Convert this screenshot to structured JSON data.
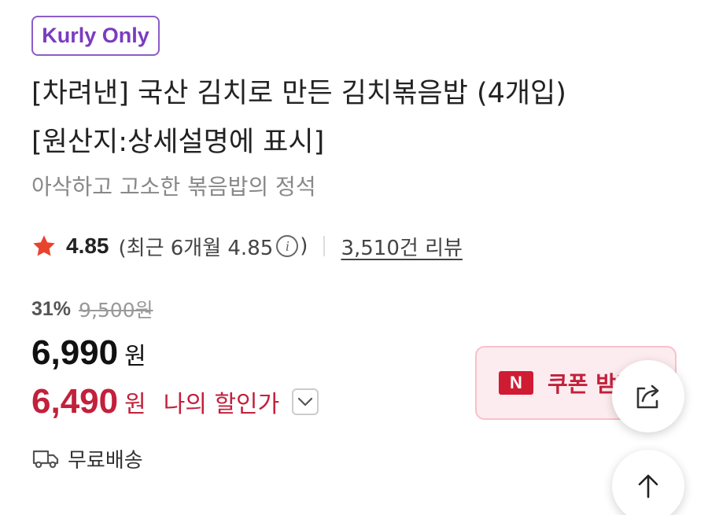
{
  "badge": {
    "label": "Kurly Only"
  },
  "product": {
    "title_line1": "[차려낸] 국산 김치로 만든 김치볶음밥 (4개입)",
    "title_line2": "[원산지:상세설명에 표시]",
    "subtitle": "아삭하고 고소한 볶음밥의 정석"
  },
  "rating": {
    "value": "4.85",
    "recent_prefix": "(최근 6개월 4.85",
    "recent_suffix": ")",
    "info_icon": "i",
    "review_count": "3,510건 리뷰"
  },
  "pricing": {
    "discount_rate": "31%",
    "original_price": "9,500원",
    "price": "6,990",
    "currency": "원",
    "my_price": "6,490",
    "my_currency": "원",
    "my_price_label": "나의 할인가"
  },
  "coupon": {
    "logo": "N",
    "label": "쿠폰 받기"
  },
  "shipping": {
    "label": "무료배송"
  },
  "icons": {
    "rating": "star-icon",
    "info": "info-icon",
    "expand": "chevron-down-icon",
    "shipping": "truck-icon",
    "share": "share-icon",
    "top": "arrow-up-icon"
  },
  "colors": {
    "accent_purple": "#7a3cc0",
    "accent_red": "#c2203b",
    "star": "#e8442d",
    "coupon_bg": "#fdecef"
  }
}
